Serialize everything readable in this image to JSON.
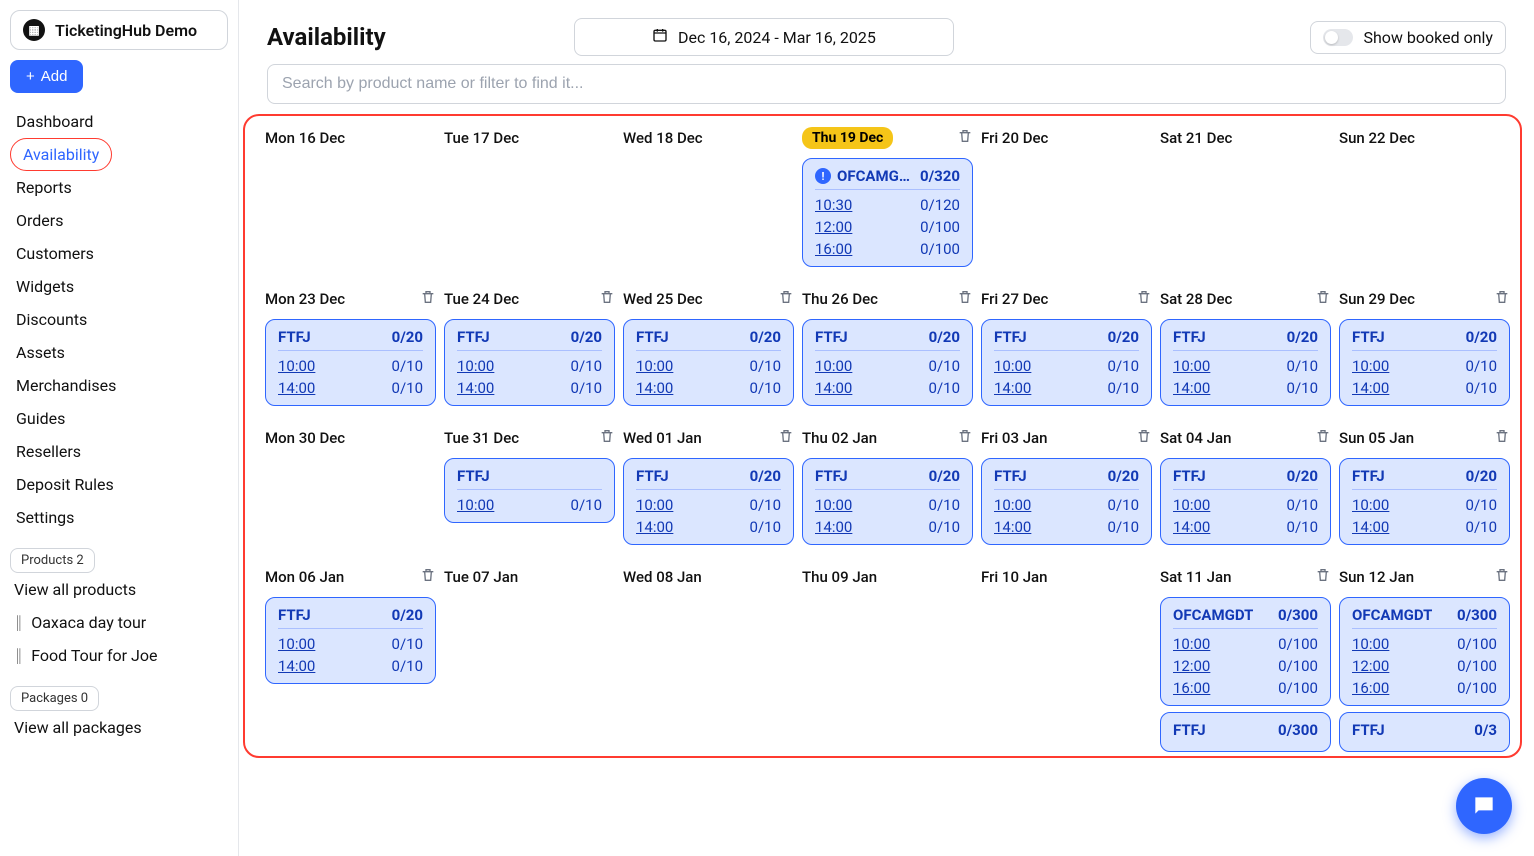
{
  "brand": {
    "name": "TicketingHub Demo"
  },
  "addButton": {
    "label": "Add"
  },
  "nav": {
    "items": [
      "Dashboard",
      "Availability",
      "Reports",
      "Orders",
      "Customers",
      "Widgets",
      "Discounts",
      "Assets",
      "Merchandises",
      "Guides",
      "Resellers",
      "Deposit Rules",
      "Settings"
    ],
    "activeIndex": 1
  },
  "productsChip": "Products 2",
  "productLinks": [
    {
      "label": "View all products",
      "hasHandle": false
    },
    {
      "label": "Oaxaca day tour",
      "hasHandle": true
    },
    {
      "label": "Food Tour for Joe",
      "hasHandle": true
    }
  ],
  "packagesChip": "Packages 0",
  "packageLinks": [
    {
      "label": "View all packages",
      "hasHandle": false
    }
  ],
  "page": {
    "title": "Availability",
    "dateRange": "Dec 16, 2024 - Mar 16, 2025",
    "bookedOnly": "Show booked only",
    "searchPlaceholder": "Search by product name or filter to find it..."
  },
  "weeks": [
    {
      "days": [
        {
          "label": "Mon 16 Dec",
          "trash": false,
          "cards": []
        },
        {
          "label": "Tue 17 Dec",
          "trash": false,
          "cards": []
        },
        {
          "label": "Wed 18 Dec",
          "trash": false,
          "cards": []
        },
        {
          "label": "Thu 19 Dec",
          "trash": true,
          "today": true,
          "cards": [
            {
              "code": "OFCAMGDT",
              "total": "0/320",
              "info": true,
              "slots": [
                {
                  "time": "10:30",
                  "val": "0/120"
                },
                {
                  "time": "12:00",
                  "val": "0/100"
                },
                {
                  "time": "16:00",
                  "val": "0/100"
                }
              ]
            }
          ]
        },
        {
          "label": "Fri 20 Dec",
          "trash": false,
          "cards": []
        },
        {
          "label": "Sat 21 Dec",
          "trash": false,
          "cards": []
        },
        {
          "label": "Sun 22 Dec",
          "trash": false,
          "cards": []
        }
      ]
    },
    {
      "days": [
        {
          "label": "Mon 23 Dec",
          "trash": true,
          "cards": [
            {
              "code": "FTFJ",
              "total": "0/20",
              "slots": [
                {
                  "time": "10:00",
                  "val": "0/10"
                },
                {
                  "time": "14:00",
                  "val": "0/10"
                }
              ]
            }
          ]
        },
        {
          "label": "Tue 24 Dec",
          "trash": true,
          "cards": [
            {
              "code": "FTFJ",
              "total": "0/20",
              "slots": [
                {
                  "time": "10:00",
                  "val": "0/10"
                },
                {
                  "time": "14:00",
                  "val": "0/10"
                }
              ]
            }
          ]
        },
        {
          "label": "Wed 25 Dec",
          "trash": true,
          "cards": [
            {
              "code": "FTFJ",
              "total": "0/20",
              "slots": [
                {
                  "time": "10:00",
                  "val": "0/10"
                },
                {
                  "time": "14:00",
                  "val": "0/10"
                }
              ]
            }
          ]
        },
        {
          "label": "Thu 26 Dec",
          "trash": true,
          "cards": [
            {
              "code": "FTFJ",
              "total": "0/20",
              "slots": [
                {
                  "time": "10:00",
                  "val": "0/10"
                },
                {
                  "time": "14:00",
                  "val": "0/10"
                }
              ]
            }
          ]
        },
        {
          "label": "Fri 27 Dec",
          "trash": true,
          "cards": [
            {
              "code": "FTFJ",
              "total": "0/20",
              "slots": [
                {
                  "time": "10:00",
                  "val": "0/10"
                },
                {
                  "time": "14:00",
                  "val": "0/10"
                }
              ]
            }
          ]
        },
        {
          "label": "Sat 28 Dec",
          "trash": true,
          "cards": [
            {
              "code": "FTFJ",
              "total": "0/20",
              "slots": [
                {
                  "time": "10:00",
                  "val": "0/10"
                },
                {
                  "time": "14:00",
                  "val": "0/10"
                }
              ]
            }
          ]
        },
        {
          "label": "Sun 29 Dec",
          "trash": true,
          "cards": [
            {
              "code": "FTFJ",
              "total": "0/20",
              "slots": [
                {
                  "time": "10:00",
                  "val": "0/10"
                },
                {
                  "time": "14:00",
                  "val": "0/10"
                }
              ]
            }
          ]
        }
      ]
    },
    {
      "days": [
        {
          "label": "Mon 30 Dec",
          "trash": false,
          "cards": []
        },
        {
          "label": "Tue 31 Dec",
          "trash": true,
          "cards": [
            {
              "code": "FTFJ",
              "total": "",
              "slots": [
                {
                  "time": "10:00",
                  "val": "0/10"
                }
              ]
            }
          ]
        },
        {
          "label": "Wed 01 Jan",
          "trash": true,
          "cards": [
            {
              "code": "FTFJ",
              "total": "0/20",
              "slots": [
                {
                  "time": "10:00",
                  "val": "0/10"
                },
                {
                  "time": "14:00",
                  "val": "0/10"
                }
              ]
            }
          ]
        },
        {
          "label": "Thu 02 Jan",
          "trash": true,
          "cards": [
            {
              "code": "FTFJ",
              "total": "0/20",
              "slots": [
                {
                  "time": "10:00",
                  "val": "0/10"
                },
                {
                  "time": "14:00",
                  "val": "0/10"
                }
              ]
            }
          ]
        },
        {
          "label": "Fri 03 Jan",
          "trash": true,
          "cards": [
            {
              "code": "FTFJ",
              "total": "0/20",
              "slots": [
                {
                  "time": "10:00",
                  "val": "0/10"
                },
                {
                  "time": "14:00",
                  "val": "0/10"
                }
              ]
            }
          ]
        },
        {
          "label": "Sat 04 Jan",
          "trash": true,
          "cards": [
            {
              "code": "FTFJ",
              "total": "0/20",
              "slots": [
                {
                  "time": "10:00",
                  "val": "0/10"
                },
                {
                  "time": "14:00",
                  "val": "0/10"
                }
              ]
            }
          ]
        },
        {
          "label": "Sun 05 Jan",
          "trash": true,
          "cards": [
            {
              "code": "FTFJ",
              "total": "0/20",
              "slots": [
                {
                  "time": "10:00",
                  "val": "0/10"
                },
                {
                  "time": "14:00",
                  "val": "0/10"
                }
              ]
            }
          ]
        }
      ]
    },
    {
      "days": [
        {
          "label": "Mon 06 Jan",
          "trash": true,
          "cards": [
            {
              "code": "FTFJ",
              "total": "0/20",
              "slots": [
                {
                  "time": "10:00",
                  "val": "0/10"
                },
                {
                  "time": "14:00",
                  "val": "0/10"
                }
              ]
            }
          ]
        },
        {
          "label": "Tue 07 Jan",
          "trash": false,
          "cards": []
        },
        {
          "label": "Wed 08 Jan",
          "trash": false,
          "cards": []
        },
        {
          "label": "Thu 09 Jan",
          "trash": false,
          "cards": []
        },
        {
          "label": "Fri 10 Jan",
          "trash": false,
          "cards": []
        },
        {
          "label": "Sat 11 Jan",
          "trash": true,
          "cards": [
            {
              "code": "OFCAMGDT",
              "total": "0/300",
              "slots": [
                {
                  "time": "10:00",
                  "val": "0/100"
                },
                {
                  "time": "12:00",
                  "val": "0/100"
                },
                {
                  "time": "16:00",
                  "val": "0/100"
                }
              ]
            },
            {
              "code": "FTFJ",
              "total": "0/300",
              "slots": []
            }
          ]
        },
        {
          "label": "Sun 12 Jan",
          "trash": true,
          "cards": [
            {
              "code": "OFCAMGDT",
              "total": "0/300",
              "slots": [
                {
                  "time": "10:00",
                  "val": "0/100"
                },
                {
                  "time": "12:00",
                  "val": "0/100"
                },
                {
                  "time": "16:00",
                  "val": "0/100"
                }
              ]
            },
            {
              "code": "FTFJ",
              "total": "0/3",
              "slots": []
            }
          ]
        }
      ]
    }
  ]
}
